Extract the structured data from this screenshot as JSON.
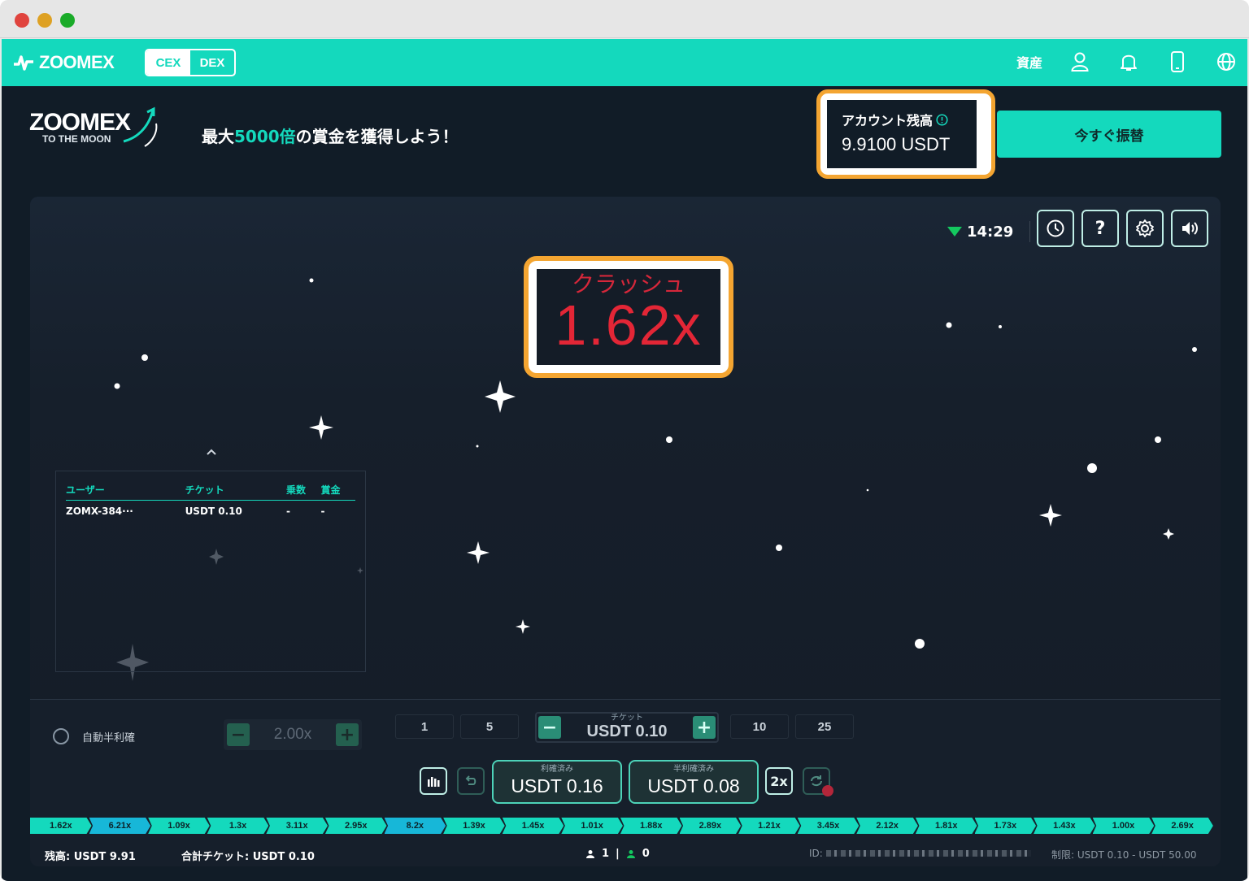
{
  "nav": {
    "brand": "ZOOMEX",
    "toggle": [
      {
        "label": "CEX",
        "active": true
      },
      {
        "label": "DEX",
        "active": false
      }
    ],
    "assets_label": "資産",
    "icons": [
      "user-icon",
      "bell-icon",
      "mobile-icon",
      "globe-icon"
    ]
  },
  "banner": {
    "logo_text": "ZOOMEX",
    "logo_tagline": "TO THE MOON",
    "headline_pre": "最大",
    "headline_highlight": "5000倍",
    "headline_post": "の賞金を獲得しよう！",
    "balance_label": "アカウント残高",
    "balance_value": "9.9100 USDT",
    "transfer_button": "今すぐ振替"
  },
  "game": {
    "time": "14:29",
    "tools": [
      {
        "name": "history-icon"
      },
      {
        "name": "help-button",
        "label": "?"
      },
      {
        "name": "settings-icon"
      },
      {
        "name": "sound-icon"
      }
    ],
    "crash_label": "クラッシュ",
    "crash_value": "1.62x",
    "players": {
      "headers": [
        "ユーザー",
        "チケット",
        "乗数",
        "賞金"
      ],
      "rows": [
        [
          "ZOMX-384···",
          "USDT 0.10",
          "-",
          "-"
        ]
      ]
    }
  },
  "controls": {
    "auto_label": "自動半利確",
    "auto_value": "2.00x",
    "quick_amounts_left": [
      "1",
      "5"
    ],
    "quick_amounts_right": [
      "10",
      "25"
    ],
    "ticket_label": "チケット",
    "ticket_value": "USDT 0.10",
    "cashout_label": "利確済み",
    "cashout_value": "USDT 0.16",
    "half_cashout_label": "半利確済み",
    "half_cashout_value": "USDT 0.08",
    "double_label": "2x"
  },
  "history": [
    "1.62x",
    "6.21x",
    "1.09x",
    "1.3x",
    "3.11x",
    "2.95x",
    "8.2x",
    "1.39x",
    "1.45x",
    "1.01x",
    "1.88x",
    "2.89x",
    "1.21x",
    "3.45x",
    "2.12x",
    "1.81x",
    "1.73x",
    "1.43x",
    "1.00x",
    "2.69x"
  ],
  "history_blue_indices": [
    1,
    6
  ],
  "footer": {
    "balance": "残高: USDT 9.91",
    "total_ticket": "合計チケット: USDT 0.10",
    "players_count": "1",
    "winners_count": "0",
    "id_label": "ID:",
    "limit": "制限: USDT 0.10 - USDT 50.00"
  },
  "colors": {
    "accent": "#14d9bd",
    "highlight": "#f4a531",
    "crash": "#e32636",
    "background": "#111c27"
  }
}
